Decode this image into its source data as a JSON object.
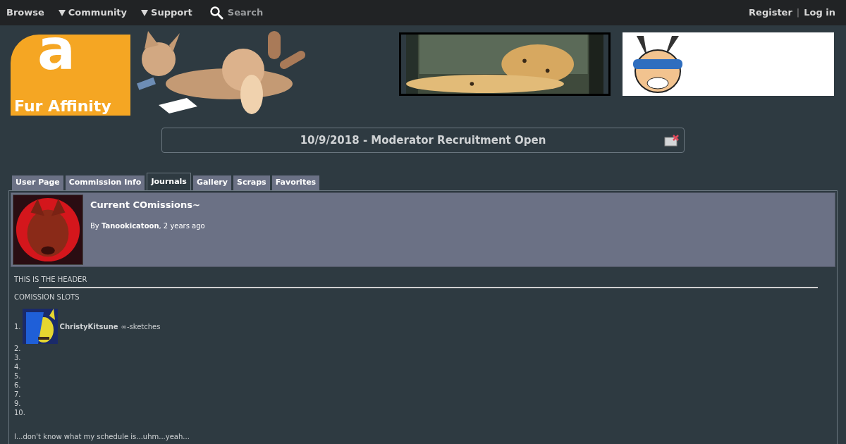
{
  "nav": {
    "left": [
      {
        "label": "Browse",
        "dropdown": false
      },
      {
        "label": "Community",
        "dropdown": true
      },
      {
        "label": "Support",
        "dropdown": true
      }
    ],
    "search": "Search",
    "right": [
      {
        "label": "Register"
      },
      {
        "label": "Log in"
      }
    ],
    "separator": "|"
  },
  "logo": {
    "letter": "a",
    "text": "Fur Affinity"
  },
  "notice": {
    "text": "10/9/2018 - Moderator Recruitment Open"
  },
  "tabs": [
    {
      "label": "User Page",
      "selected": false
    },
    {
      "label": "Commission Info",
      "selected": false
    },
    {
      "label": "Journals",
      "selected": true
    },
    {
      "label": "Gallery",
      "selected": false
    },
    {
      "label": "Scraps",
      "selected": false
    },
    {
      "label": "Favorites",
      "selected": false
    }
  ],
  "journal": {
    "title": "Current COmissions~",
    "by": "By",
    "author": "Tanookicatoon",
    "age": ", 2 years ago"
  },
  "body": {
    "header": "THIS IS THE HEADER",
    "section": "COMISSION SLOTS",
    "slots": [
      {
        "number": "1.",
        "user": "ChristyKitsune",
        "note": "∞-sketches"
      },
      {
        "number": "2."
      },
      {
        "number": "3."
      },
      {
        "number": "4."
      },
      {
        "number": "5."
      },
      {
        "number": "6."
      },
      {
        "number": "7."
      },
      {
        "number": "9."
      },
      {
        "number": "10."
      }
    ],
    "footer": "I...don't know what my schedule is...uhm...yeah..."
  }
}
